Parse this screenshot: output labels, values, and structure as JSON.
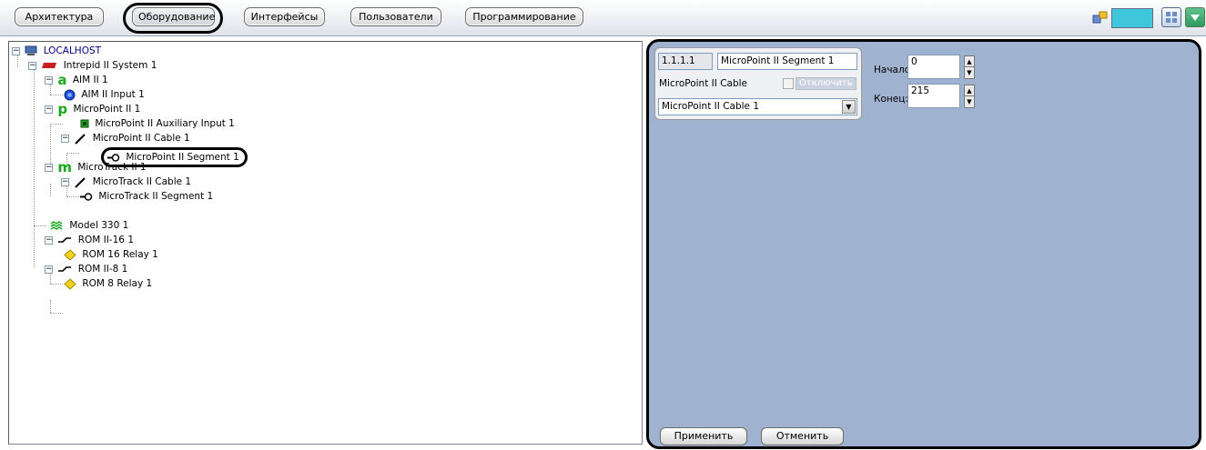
{
  "toolbar": {
    "tabs": [
      "Архитектура",
      "Оборудование",
      "Интерфейсы",
      "Пользователи",
      "Программирование"
    ],
    "active_tab": "Оборудование"
  },
  "tree": {
    "items": [
      {
        "label": "LOCALHOST",
        "icon": "computer-icon"
      },
      {
        "label": "Intrepid II System 1",
        "icon": "intrepid-system-icon"
      },
      {
        "label": "AIM II 1",
        "icon": "letter-a-icon"
      },
      {
        "label": "AIM II Input 1",
        "icon": "blue-circle-icon"
      },
      {
        "label": "MicroPoint II 1",
        "icon": "letter-p-icon"
      },
      {
        "label": "MicroPoint II Auxiliary Input 1",
        "icon": "green-square-icon"
      },
      {
        "label": "MicroPoint II Cable 1",
        "icon": "cable-icon"
      },
      {
        "label": "MicroPoint II Segment 1",
        "icon": "segment-icon"
      },
      {
        "label": "MicroTrack II 1",
        "icon": "letter-m-icon"
      },
      {
        "label": "MicroTrack II Cable 1",
        "icon": "cable-icon"
      },
      {
        "label": "MicroTrack II Segment 1",
        "icon": "segment-icon"
      },
      {
        "label": "Model 330 1",
        "icon": "wave-icon"
      },
      {
        "label": "ROM II-16 1",
        "icon": "relay-module-icon"
      },
      {
        "label": "ROM 16 Relay 1",
        "icon": "yellow-diamond-icon"
      },
      {
        "label": "ROM II-8 1",
        "icon": "relay-module-icon"
      },
      {
        "label": "ROM 8 Relay 1",
        "icon": "yellow-diamond-icon"
      }
    ]
  },
  "settings": {
    "id_value": "1.1.1.1",
    "name_value": "MicroPoint II Segment 1",
    "cable_label": "MicroPoint II Cable",
    "disable_label": "Отключить",
    "cable_select": "MicroPoint II Cable 1",
    "start_label": "Начало:",
    "start_value": "0",
    "end_label": "Конец:",
    "end_value": "215",
    "apply_label": "Применить",
    "cancel_label": "Отменить"
  },
  "colors": {
    "panel_bg": "#9fb2cf",
    "accent_cyan": "#40c6dc"
  }
}
